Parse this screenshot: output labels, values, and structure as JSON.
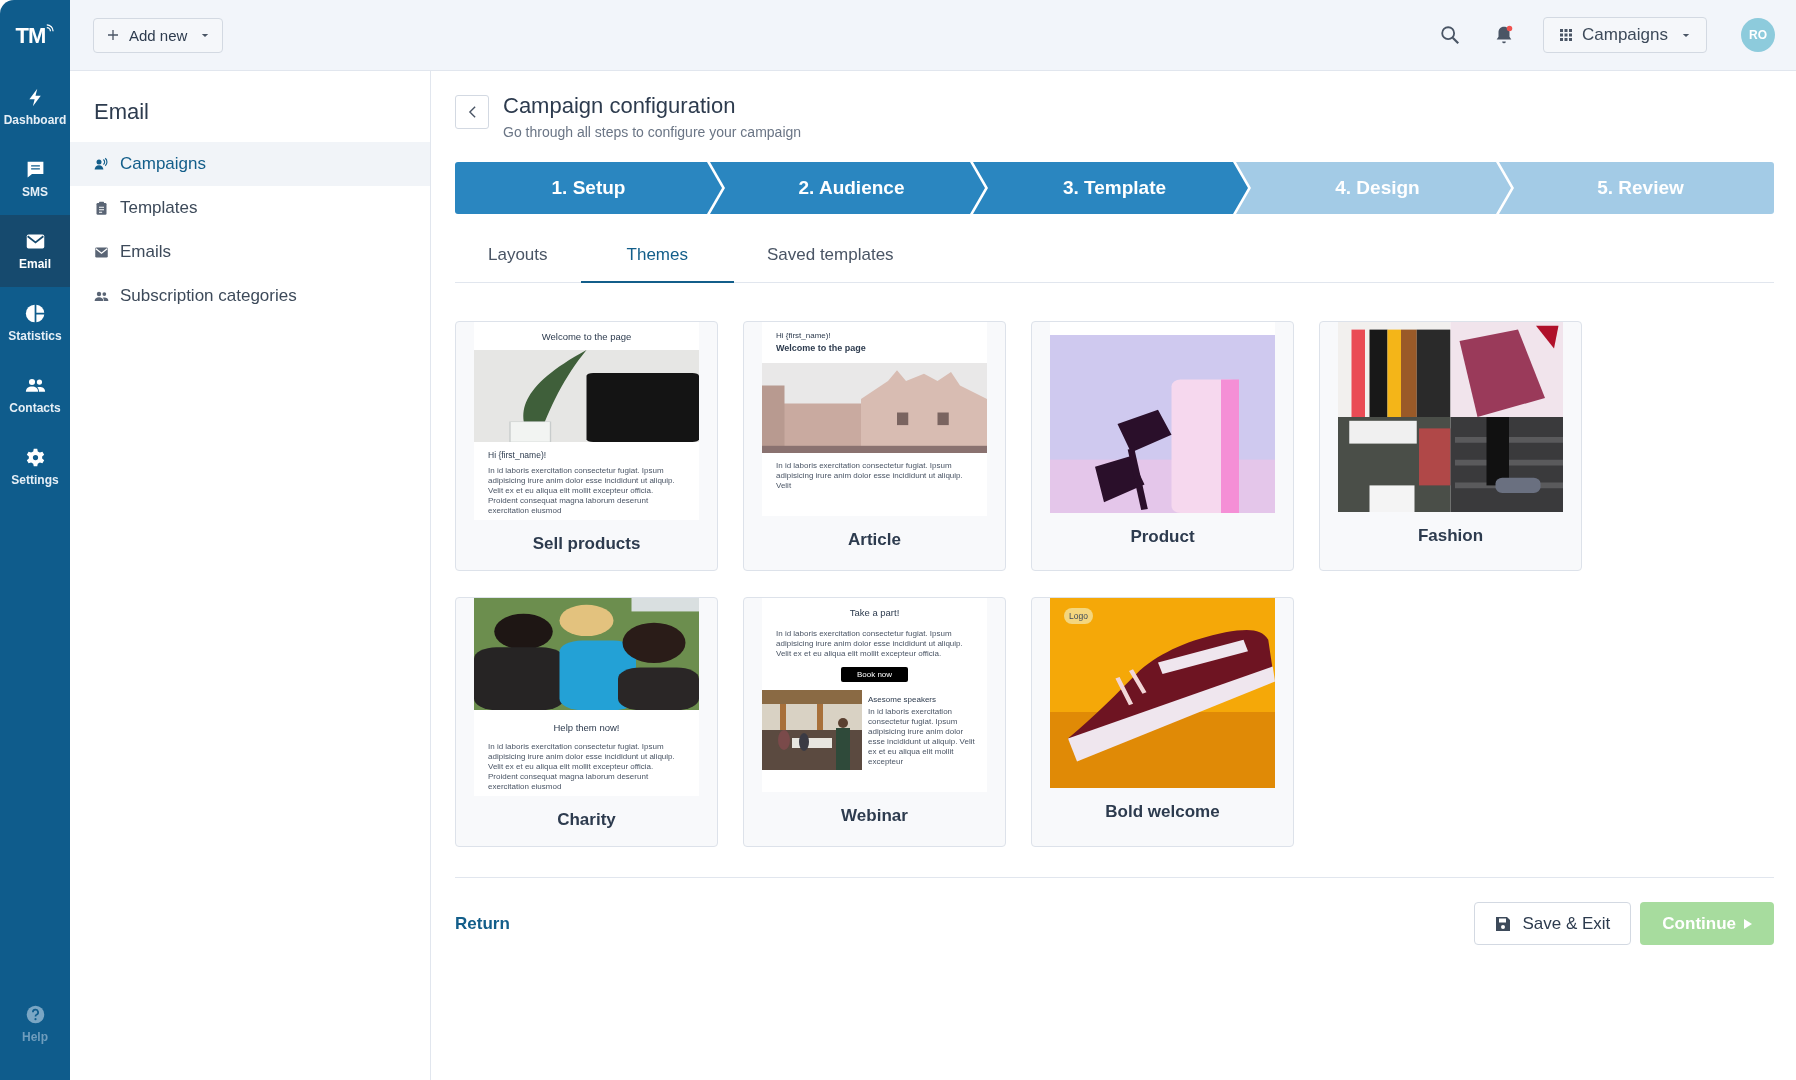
{
  "brand": {
    "logo": "TM"
  },
  "topbar": {
    "add_button": "Add new",
    "app_switcher": "Campaigns",
    "avatar": "RO",
    "has_notification": true
  },
  "nav": [
    {
      "label": "Dashboard",
      "selected": false
    },
    {
      "label": "SMS",
      "selected": false
    },
    {
      "label": "Email",
      "selected": true
    },
    {
      "label": "Statistics",
      "selected": false
    },
    {
      "label": "Contacts",
      "selected": false
    },
    {
      "label": "Settings",
      "selected": false
    }
  ],
  "help": {
    "label": "Help"
  },
  "section": {
    "title": "Email",
    "items": [
      {
        "label": "Campaigns",
        "selected": true
      },
      {
        "label": "Templates",
        "selected": false
      },
      {
        "label": "Emails",
        "selected": false
      },
      {
        "label": "Subscription categories",
        "selected": false
      }
    ]
  },
  "header": {
    "title": "Campaign configuration",
    "subtitle": "Go through all steps to configure your campaign"
  },
  "steps": [
    {
      "label": "1. Setup",
      "reached": true
    },
    {
      "label": "2. Audience",
      "reached": true
    },
    {
      "label": "3. Template",
      "reached": true
    },
    {
      "label": "4. Design",
      "reached": false
    },
    {
      "label": "5. Review",
      "reached": false
    }
  ],
  "tabs": [
    {
      "label": "Layouts",
      "selected": false
    },
    {
      "label": "Themes",
      "selected": true
    },
    {
      "label": "Saved templates",
      "selected": false
    }
  ],
  "themes": [
    {
      "name": "Sell products",
      "blocks": [
        {
          "kind": "title",
          "text": "Welcome to the page"
        },
        {
          "kind": "picture"
        },
        {
          "kind": "greeting",
          "text": "Hi {first_name)!"
        },
        {
          "kind": "text",
          "text": "In id laboris exercitation consectetur fugiat. Ipsum adipisicing irure anim dolor esse incididunt ut aliquip. Velit ex et eu aliqua elit mollit excepteur officia. Proident consequat magna laborum deserunt exercitation eiusmod"
        }
      ]
    },
    {
      "name": "Article",
      "blocks": [
        {
          "kind": "small",
          "text": "Hi {first_name)!"
        },
        {
          "kind": "heading",
          "text": "Welcome to the page"
        },
        {
          "kind": "picture"
        },
        {
          "kind": "text",
          "text": "In id laboris exercitation consectetur fugiat. Ipsum adipisicing irure anim dolor esse incididunt ut aliquip. Velit"
        }
      ]
    },
    {
      "name": "Product",
      "blocks": [
        {
          "kind": "picture"
        }
      ]
    },
    {
      "name": "Fashion",
      "blocks": [
        {
          "kind": "picture"
        }
      ]
    },
    {
      "name": "Charity",
      "blocks": [
        {
          "kind": "picture"
        },
        {
          "kind": "title",
          "text": "Help them now!"
        },
        {
          "kind": "text",
          "text": "In id laboris exercitation consectetur fugiat. Ipsum adipisicing irure anim dolor esse incididunt ut aliquip. Velit ex et eu aliqua elit mollit excepteur officia. Proident consequat magna laborum deserunt exercitation eiusmod"
        }
      ]
    },
    {
      "name": "Webinar",
      "blocks": [
        {
          "kind": "title",
          "text": "Take a part!"
        },
        {
          "kind": "text",
          "text": "In id laboris exercitation consectetur fugiat. Ipsum adipisicing irure anim dolor esse incididunt ut aliquip. Velit ex et eu aliqua elit mollit excepteur officia."
        },
        {
          "kind": "button",
          "text": "Book now"
        },
        {
          "kind": "split",
          "heading": "Asesome speakers",
          "text": "In id laboris exercitation consectetur fugiat. Ipsum adipisicing irure anim dolor esse incididunt ut aliquip. Velit ex et eu aliqua elit mollit excepteur"
        }
      ]
    },
    {
      "name": "Bold welcome",
      "blocks": [
        {
          "kind": "picture",
          "badge": "Logo"
        }
      ]
    }
  ],
  "footer": {
    "return": "Return",
    "save": "Save & Exit",
    "continue": "Continue",
    "continue_disabled": true
  }
}
